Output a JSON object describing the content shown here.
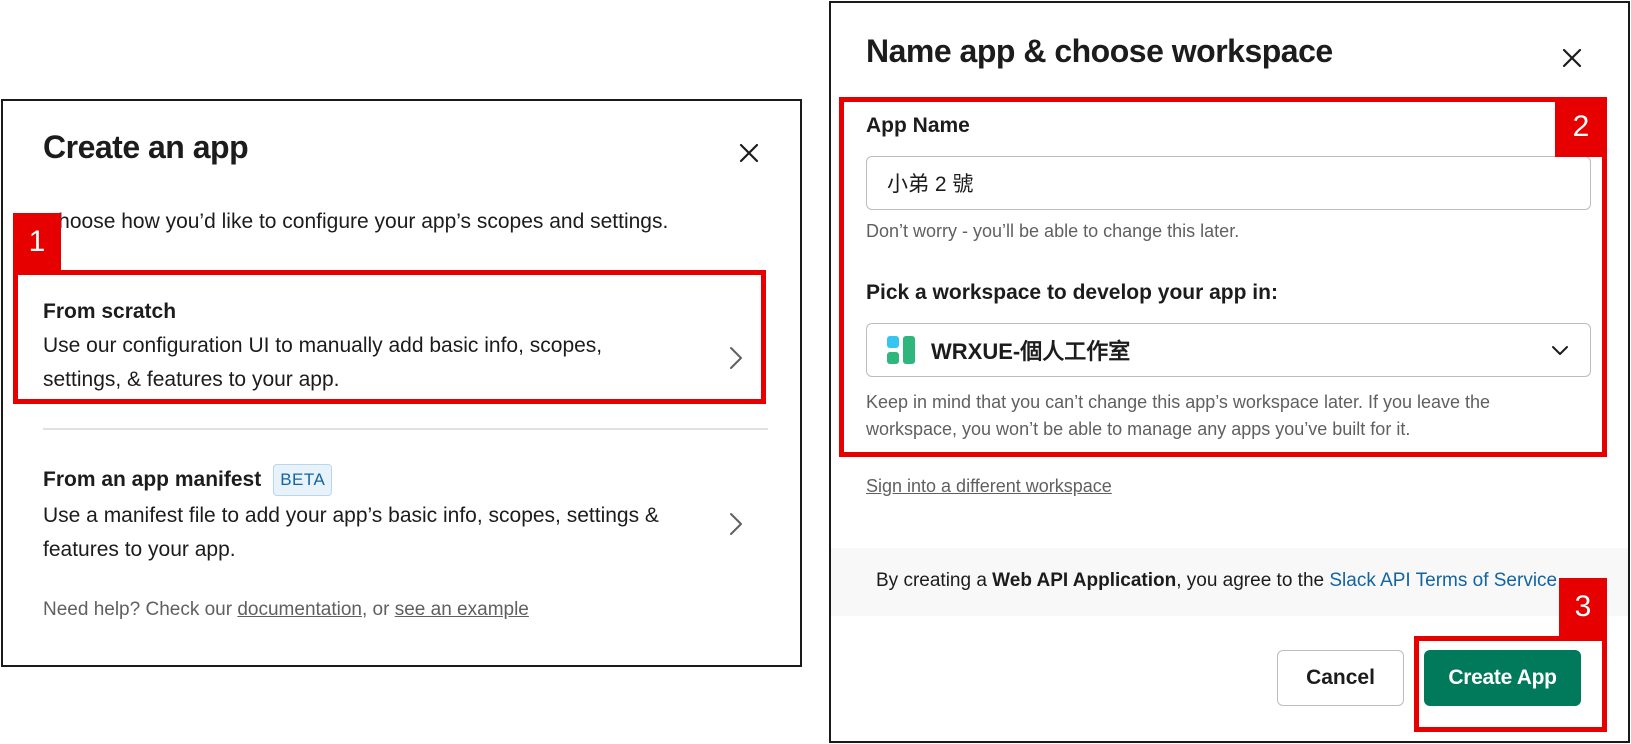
{
  "create_app_dialog": {
    "title": "Create an app",
    "subtitle": "Choose how you’d like to configure your app’s scopes and settings.",
    "options": [
      {
        "title": "From scratch",
        "description": "Use our configuration UI to manually add basic info, scopes, settings, & features to your app.",
        "icon": "chevron-right-icon"
      },
      {
        "title": "From an app manifest",
        "badge": "BETA",
        "description": "Use a manifest file to add your app’s basic info, scopes, settings & features to your app.",
        "icon": "chevron-right-icon"
      }
    ],
    "help": {
      "prefix": "Need help? Check our ",
      "documentation_link": "documentation",
      "middle": ", or ",
      "example_link": "see an example"
    },
    "close_icon": "close-icon"
  },
  "name_app_dialog": {
    "title": "Name app & choose workspace",
    "app_name": {
      "label": "App Name",
      "value": "小弟 2 號",
      "hint": "Don’t worry - you’ll be able to change this later."
    },
    "workspace": {
      "label": "Pick a workspace to develop your app in:",
      "selected": "WRXUE-個人工作室",
      "hint": "Keep in mind that you can’t change this app’s workspace later. If you leave the workspace, you won’t be able to manage any apps you’ve built for it."
    },
    "sign_in_link": "Sign into a different workspace",
    "terms": {
      "prefix": "By creating a ",
      "bold": "Web API Application",
      "middle": ", you agree to the ",
      "link": "Slack API Terms of Service"
    },
    "cancel_label": "Cancel",
    "create_label": "Create App",
    "colors": {
      "primary_button": "#007a5a",
      "link": "#1264a3"
    }
  },
  "annotations": [
    {
      "label": "1"
    },
    {
      "label": "2"
    },
    {
      "label": "3"
    }
  ]
}
